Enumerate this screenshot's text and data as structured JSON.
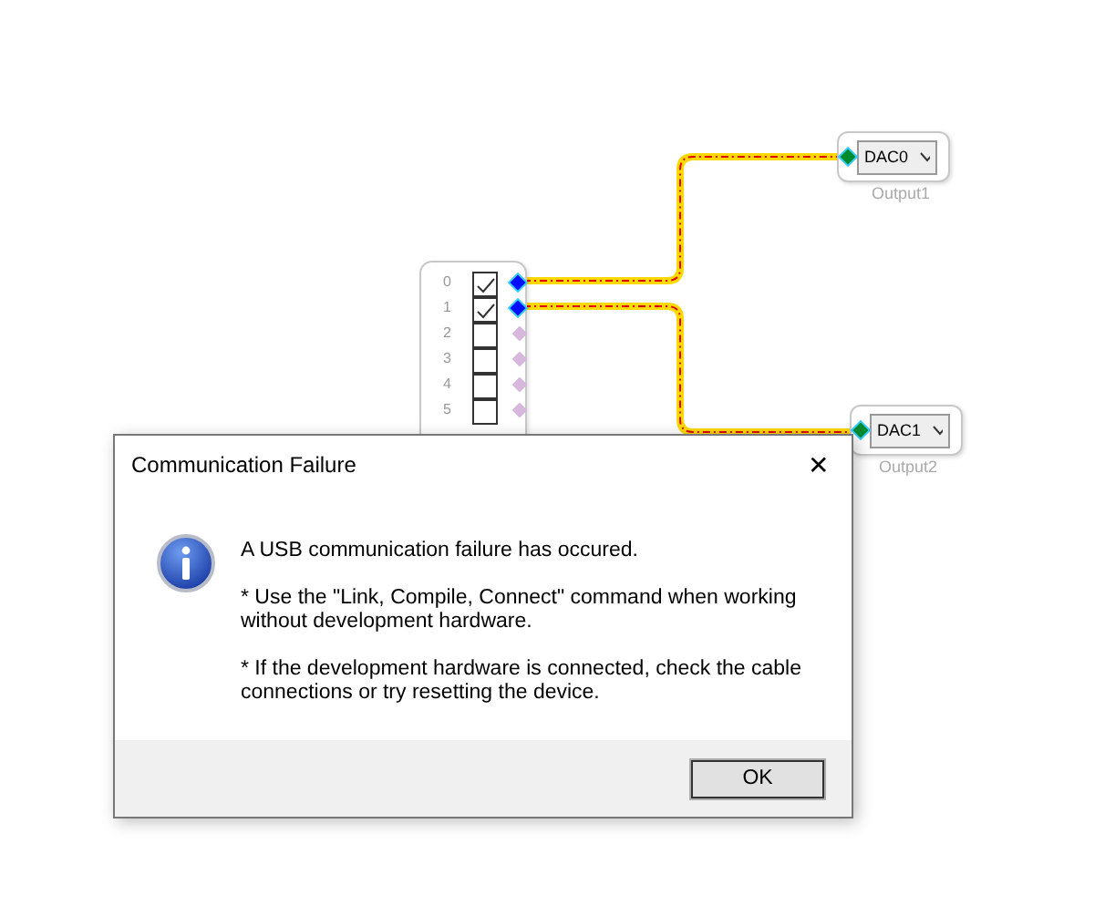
{
  "canvas": {
    "input_block": {
      "pins": [
        {
          "label": "0",
          "checked": true,
          "connected": true
        },
        {
          "label": "1",
          "checked": true,
          "connected": true
        },
        {
          "label": "2",
          "checked": false,
          "connected": false
        },
        {
          "label": "3",
          "checked": false,
          "connected": false
        },
        {
          "label": "4",
          "checked": false,
          "connected": false
        },
        {
          "label": "5",
          "checked": false,
          "connected": false
        }
      ]
    },
    "outputs": [
      {
        "value": "DAC0",
        "label": "Output1"
      },
      {
        "value": "DAC1",
        "label": "Output2"
      }
    ]
  },
  "dialog": {
    "title": "Communication Failure",
    "close": "✕",
    "paragraphs": [
      "A USB communication failure has occured.",
      "* Use the \"Link, Compile, Connect\" command when working without development hardware.",
      "* If the development hardware is connected, check the cable connections or try resetting the device."
    ],
    "button": "OK"
  }
}
